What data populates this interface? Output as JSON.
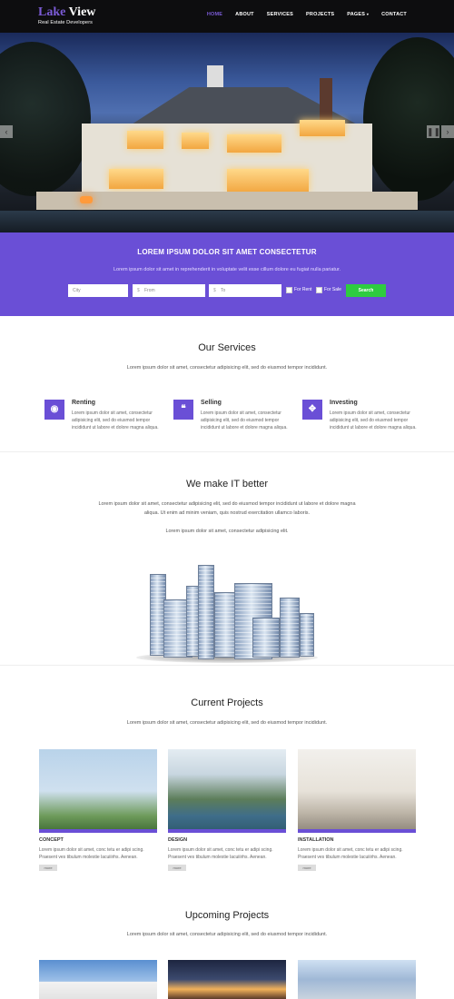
{
  "brand": {
    "name_part1": "Lake",
    "name_part2": "View",
    "tagline": "Real Estate Developers",
    "accent": "#6a4fd6"
  },
  "nav": {
    "items": [
      "HOME",
      "ABOUT",
      "SERVICES",
      "PROJECTS",
      "PAGES",
      "CONTACT"
    ],
    "active": "HOME",
    "dropdown_caret": "▾"
  },
  "hero": {
    "prev_icon": "‹",
    "next_icon": "›",
    "pause_icon": "❚❚"
  },
  "search": {
    "title": "LOREM IPSUM DOLOR SIT AMET CONSECTETUR",
    "text": "Lorem ipsum dolor sit amet in reprehenderit in voluptate velit esse cillum dolore eu fugiat nulla pariatur.",
    "city_placeholder": "City",
    "from_placeholder": "From",
    "to_placeholder": "To",
    "currency": "$",
    "for_rent": "For Rent",
    "for_sale": "For Sale",
    "button": "Search",
    "button_color": "#2ecc40"
  },
  "services": {
    "title": "Our Services",
    "subtitle": "Lorem ipsum dolor sit amet, consectetur adipisicing elit, sed do eiusmod tempor incididunt.",
    "items": [
      {
        "icon": "eye-icon",
        "glyph": "◉",
        "title": "Renting",
        "text": "Lorem ipsum dolor sit amet, consectetur adipisicing elit, sed do eiusmod tempor incididunt ut labore et dolore magna aliqua."
      },
      {
        "icon": "quote-icon",
        "glyph": "❝",
        "title": "Selling",
        "text": "Lorem ipsum dolor sit amet, consectetur adipisicing elit, sed do eiusmod tempor incididunt ut labore et dolore magna aliqua."
      },
      {
        "icon": "move-arrows-icon",
        "glyph": "✥",
        "title": "Investing",
        "text": "Lorem ipsum dolor sit amet, consectetur adipisicing elit, sed do eiusmod tempor incididunt ut labore et dolore magna aliqua."
      }
    ]
  },
  "it": {
    "title": "We make IT better",
    "text1": "Lorem ipsum dolor sit amet, consectetur adipisicing elit, sed do eiusmod tempor incididunt ut labore et dolore magna aliqua. Ut enim ad minim veniam, quis nostrud exercitation ullamco laboris.",
    "text2": "Lorem ipsum dolor sit amet, consectetur adipisicing elit."
  },
  "current": {
    "title": "Current Projects",
    "subtitle": "Lorem ipsum dolor sit amet, consectetur adipisicing elit, sed do eiusmod tempor incididunt.",
    "items": [
      {
        "label": "CONCEPT",
        "text": "Lorem ipsum dolor sit amet, conc tetu er adipi scing. Praesent ves tibulum molestie lacuiiirhs. Aenean.",
        "more": "more"
      },
      {
        "label": "DESIGN",
        "text": "Lorem ipsum dolor sit amet, conc tetu er adipi scing. Praesent ves tibulum molestie lacuiiirhs. Aenean.",
        "more": "more"
      },
      {
        "label": "INSTALLATION",
        "text": "Lorem ipsum dolor sit amet, conc tetu er adipi scing. Praesent ves tibulum molestie lacuiiirhs. Aenean.",
        "more": "more"
      }
    ]
  },
  "upcoming": {
    "title": "Upcoming Projects",
    "subtitle": "Lorem ipsum dolor sit amet, consectetur adipisicing elit, sed do eiusmod tempor incididunt."
  }
}
